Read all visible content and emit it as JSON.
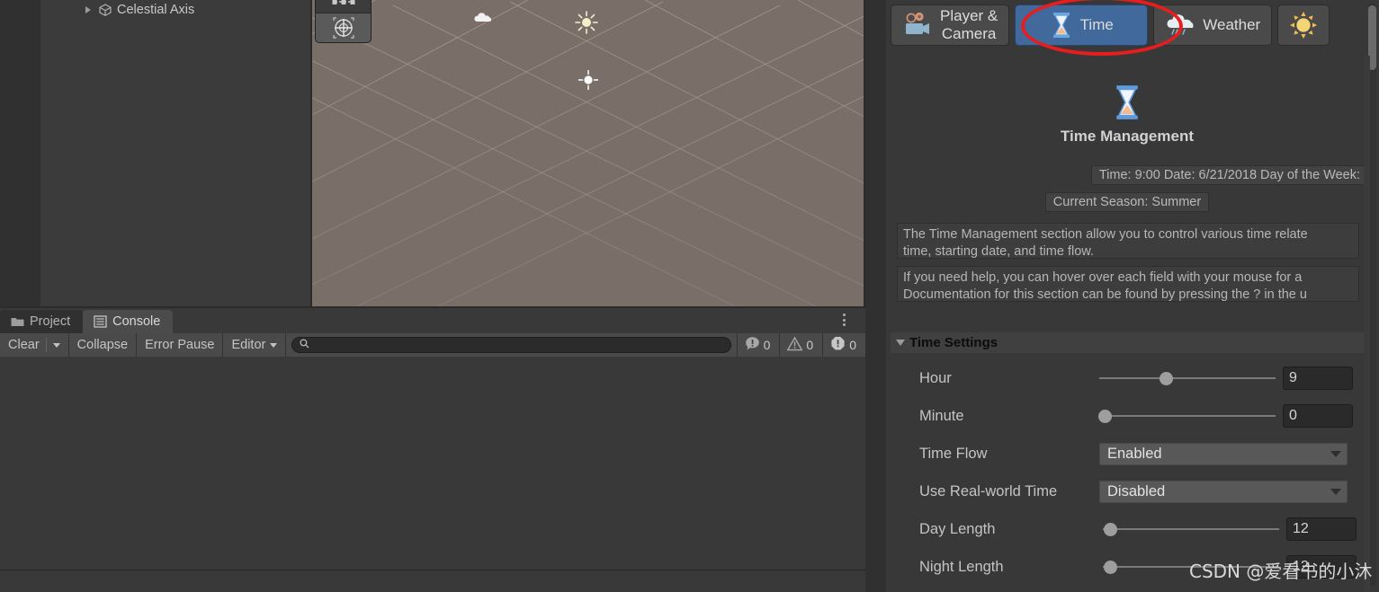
{
  "hierarchy": {
    "items": [
      {
        "label": "Celestial Axis",
        "icon": "cube-icon",
        "expand_icon": "chevron-right-icon"
      }
    ]
  },
  "scene": {
    "tools": [
      {
        "name": "pivot-center-toggle",
        "icon": "pivot-icon"
      },
      {
        "name": "rect-transform-tool",
        "icon": "move-rotate-gizmo-icon"
      }
    ],
    "gizmos": [
      {
        "name": "cloud-gizmo",
        "icon": "cloud-icon"
      },
      {
        "name": "directional-light-gizmo",
        "icon": "sun-icon"
      },
      {
        "name": "point-light-gizmo",
        "icon": "light-icon"
      }
    ]
  },
  "bottom_panel": {
    "tabs": [
      {
        "label": "Project",
        "icon": "folder-icon",
        "active": false
      },
      {
        "label": "Console",
        "icon": "console-list-icon",
        "active": true
      }
    ],
    "menu_icon": "kebab-menu-icon",
    "toolbar": {
      "clear_label": "Clear",
      "clear_dropdown_icon": "chevron-down-icon",
      "collapse_label": "Collapse",
      "error_pause_label": "Error Pause",
      "editor_label": "Editor",
      "editor_dropdown_icon": "chevron-down-icon",
      "search_placeholder": "",
      "search_value": "",
      "search_icon": "search-icon"
    },
    "counts": [
      {
        "icon": "info-log-icon",
        "value": "0"
      },
      {
        "icon": "warning-icon",
        "value": "0"
      },
      {
        "icon": "error-icon",
        "value": "0"
      }
    ]
  },
  "inspector": {
    "tabs": [
      {
        "label": "Player & Camera",
        "label_line1": "Player &",
        "label_line2": "Camera",
        "icon": "player-camera-icon",
        "selected": false
      },
      {
        "label": "Time",
        "icon": "hourglass-icon",
        "selected": true
      },
      {
        "label": "Weather",
        "icon": "rain-cloud-icon",
        "selected": false
      },
      {
        "label": "",
        "icon": "sun-icon",
        "selected": false
      }
    ],
    "header": {
      "icon": "hourglass-icon",
      "title": "Time Management"
    },
    "status": {
      "line1": "Time: 9:00  Date: 6/21/2018  Day of the Week:",
      "line2": "Current Season: Summer"
    },
    "descriptions": [
      {
        "line1": "The Time Management section allow you to control various time relate",
        "line2": "time, starting date, and time flow."
      },
      {
        "line1": "If you need help, you can hover over each field with your mouse for a",
        "line2": "Documentation for this section can be found by pressing the ? in the u"
      }
    ],
    "settings_section": {
      "title": "Time Settings",
      "foldout_icon": "triangle-down-icon",
      "fields": [
        {
          "name": "hour",
          "label": "Hour",
          "control": "slider",
          "value": "9",
          "fill_pct": 38
        },
        {
          "name": "minute",
          "label": "Minute",
          "control": "slider",
          "value": "0",
          "fill_pct": 2
        },
        {
          "name": "time-flow",
          "label": "Time Flow",
          "control": "dropdown",
          "value": "Enabled"
        },
        {
          "name": "use-real-world-time",
          "label": "Use Real-world Time",
          "control": "dropdown",
          "value": "Disabled"
        },
        {
          "name": "day-length",
          "label": "Day Length",
          "control": "slider",
          "value": "12",
          "fill_pct": 4
        },
        {
          "name": "night-length",
          "label": "Night Length",
          "control": "slider",
          "value": "12",
          "fill_pct": 4
        }
      ]
    },
    "annotation": {
      "shape": "red-ellipse",
      "around": "Time"
    }
  },
  "watermark": {
    "text": "CSDN @爱看书的小沐"
  },
  "colors": {
    "panel_bg": "#383838",
    "selected_tab": "#41699b",
    "annotation_red": "#e81d1d",
    "scene_bg": "#7a6f68"
  }
}
